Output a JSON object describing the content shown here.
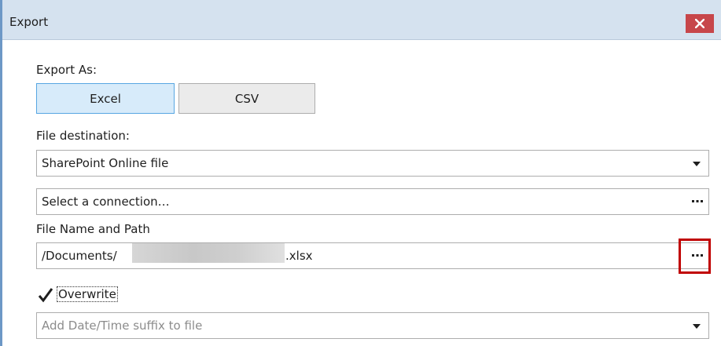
{
  "window": {
    "title": "Export",
    "close_icon": "close-icon"
  },
  "export_as": {
    "label": "Export As:",
    "options": [
      {
        "label": "Excel",
        "selected": true
      },
      {
        "label": "CSV",
        "selected": false
      }
    ]
  },
  "file_destination": {
    "label": "File destination:",
    "selected_value": "SharePoint Online file",
    "connection_placeholder": "Select a connection…"
  },
  "file_name": {
    "label": "File Name and Path",
    "path_prefix": "/Documents/",
    "path_suffix": ".xlsx",
    "browse_label": "…"
  },
  "overwrite": {
    "label": "Overwrite",
    "checked": true
  },
  "date_suffix": {
    "placeholder": "Add Date/Time suffix to file"
  },
  "colors": {
    "title_bar": "#d5e2ef",
    "close_button": "#c7464a",
    "selected_button": "#d7ebfa",
    "selected_border": "#57a6e2",
    "highlight_box": "#c00000"
  }
}
